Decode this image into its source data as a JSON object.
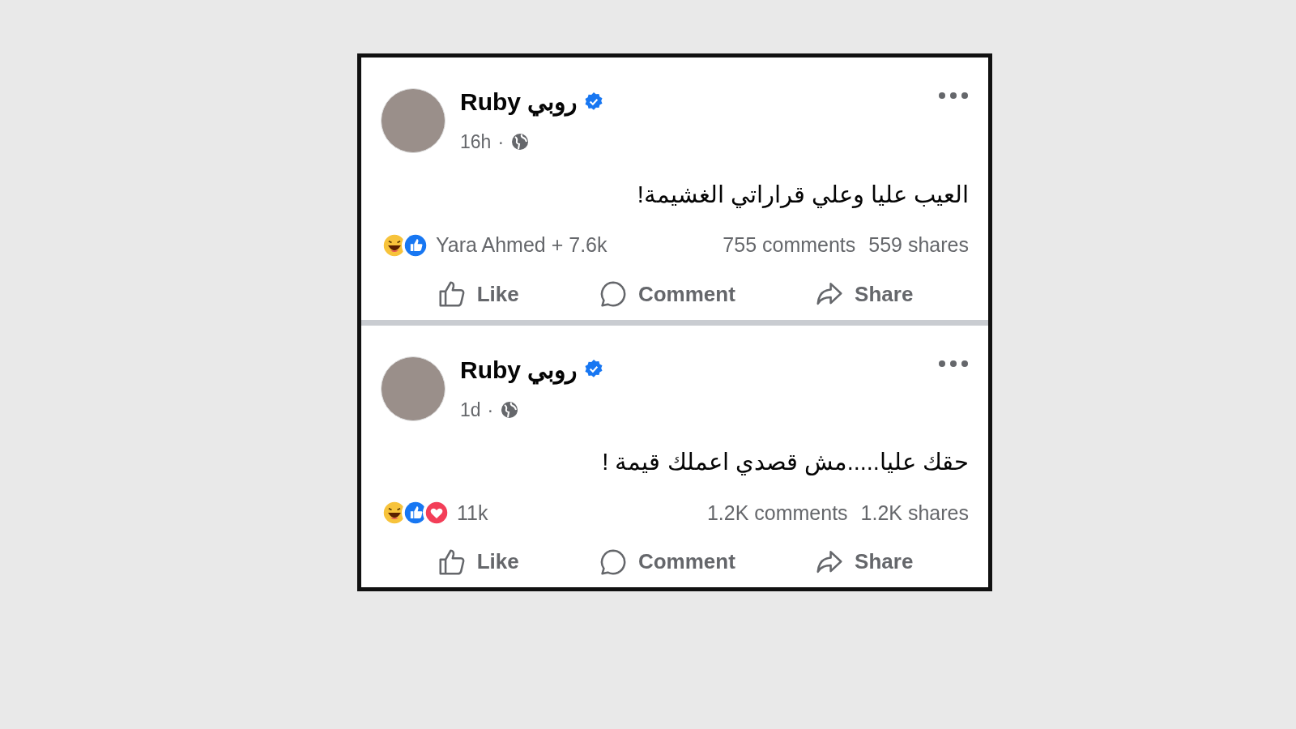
{
  "posts": [
    {
      "author": "Ruby روبي",
      "verified": true,
      "time": "16h",
      "separator": "·",
      "text": "العيب عليا وعلي قراراتي الغشيمة!",
      "reactions": [
        {
          "kind": "haha"
        },
        {
          "kind": "like"
        }
      ],
      "reaction_count": "Yara Ahmed + 7.6k",
      "comments": "755 comments",
      "shares": "559 shares",
      "actions": [
        {
          "kind": "like",
          "label": "Like"
        },
        {
          "kind": "comment",
          "label": "Comment"
        },
        {
          "kind": "share",
          "label": "Share"
        }
      ]
    },
    {
      "author": "Ruby روبي",
      "verified": true,
      "time": "1d",
      "separator": "·",
      "text": "حقك عليا.....مش قصدي اعملك قيمة !",
      "reactions": [
        {
          "kind": "haha"
        },
        {
          "kind": "like"
        },
        {
          "kind": "love"
        }
      ],
      "reaction_count": "11k",
      "comments": "1.2K comments",
      "shares": "1.2K shares",
      "actions": [
        {
          "kind": "like",
          "label": "Like"
        },
        {
          "kind": "comment",
          "label": "Comment"
        },
        {
          "kind": "share",
          "label": "Share"
        }
      ]
    }
  ]
}
